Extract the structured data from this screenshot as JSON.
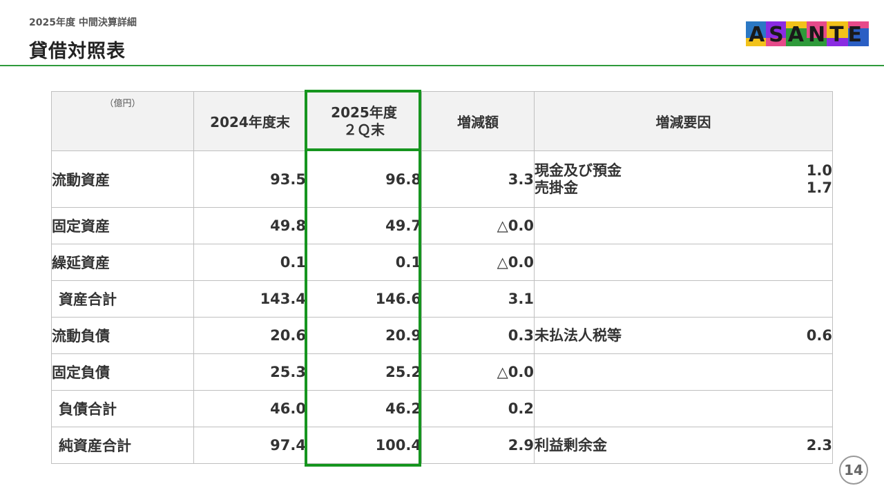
{
  "header": {
    "subtitle": "2025年度 中間決算詳細",
    "title": "貸借対照表"
  },
  "logo": {
    "text": "ASANTE",
    "icon": "asante-logo"
  },
  "colors": {
    "accent_green": "#16951f",
    "header_line": "#2e9a3a"
  },
  "table": {
    "unit": "（億円）",
    "col_prev": "2024年度末",
    "col_cur_line1": "2025年度",
    "col_cur_line2": "２Ｑ末",
    "col_diff": "増減額",
    "col_reason": "増減要因",
    "rows": [
      {
        "label": "流動資産",
        "prev": "93.5",
        "cur": "96.8",
        "diff": "3.3",
        "reasons": [
          {
            "text": "現金及び預金",
            "value": "1.0"
          },
          {
            "text": "売掛金",
            "value": "1.7"
          }
        ]
      },
      {
        "label": "固定資産",
        "prev": "49.8",
        "cur": "49.7",
        "diff": "△0.0"
      },
      {
        "label": "繰延資産",
        "prev": "0.1",
        "cur": "0.1",
        "diff": "△0.0"
      },
      {
        "label": "資産合計",
        "prev": "143.4",
        "cur": "146.6",
        "diff": "3.1"
      },
      {
        "label": "流動負債",
        "prev": "20.6",
        "cur": "20.9",
        "diff": "0.3",
        "reasons": [
          {
            "text": "未払法人税等",
            "value": "0.6"
          }
        ]
      },
      {
        "label": "固定負債",
        "prev": "25.3",
        "cur": "25.2",
        "diff": "△0.0"
      },
      {
        "label": "負債合計",
        "prev": "46.0",
        "cur": "46.2",
        "diff": "0.2"
      },
      {
        "label": "純資産合計",
        "prev": "97.4",
        "cur": "100.4",
        "diff": "2.9",
        "reasons": [
          {
            "text": "利益剰余金",
            "value": "2.3"
          }
        ]
      }
    ]
  },
  "page_number": "14"
}
